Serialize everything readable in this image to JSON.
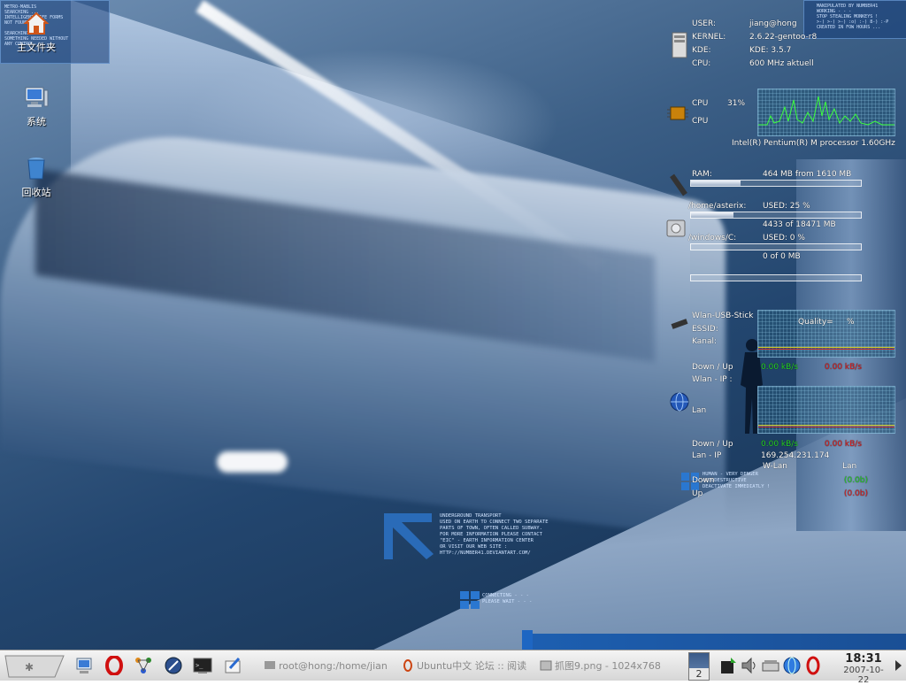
{
  "desktop": {
    "icons": [
      {
        "label": "主文件夹",
        "icon": "home-folder-icon"
      },
      {
        "label": "系统",
        "icon": "computer-icon"
      },
      {
        "label": "回收站",
        "icon": "trash-icon"
      }
    ],
    "top_left_panel": "METRO-MABLIS\nSEARCHING ...\nINTELLIGENT LIFE FORMS\nNOT FOUND\n\nSEARCHING ...\nSOMETHING NEEDED WITHOUT\nANY CONTROL",
    "top_right_panel": "MANIPULATED BY NUMBER41\nWORKING - - -\nSTOP STEALING MONKEYS !\n>-) >-) >-) :o) :-) 8-) :-P\nCREATED IN FOW HOURS ...",
    "bottom_text": "UNDERGROUND TRANSPORT\nUSED ON EARTH TO CONNECT TWO SEPARATE\nPARTS OF TOWN, OFTEN CALLED SUBWAY.\nFOR MORE INFORMATION PLEASE CONTACT\n\"EIC\" - EARTH INFORMATION CENTER\nOR VISIT OUR WEB SITE :\nHTTP://NUMBER41.DEVIANTART.COM/",
    "connecting_text": "CONNECTING - - -\nPLEASE WAIT - - -",
    "warning_text": "HUMAN - VERY DENGER\nAUTODESTRUCTIVE\nDEACTIVATE IMMEDIATLY !"
  },
  "sysinfo": {
    "user_label": "USER:",
    "user": "jiang@hong",
    "kernel_label": "KERNEL:",
    "kernel": "2.6.22-gentoo-r8",
    "kde_label": "KDE:",
    "kde": "KDE: 3.5.7",
    "cpu_label": "CPU:",
    "cpu": "600 MHz aktuell"
  },
  "cpu_monitor": {
    "label1": "CPU",
    "label2": "CPU",
    "percent": "31%",
    "processor": "Intel(R) Pentium(R) M processor 1.60GHz",
    "load_fraction": 0.31
  },
  "memory": {
    "ram_label": "RAM:",
    "ram_value": "464 MB from 1610 MB",
    "ram_fraction": 0.29,
    "home_label": "/home/asterix:",
    "home_used": "USED: 25 %",
    "home_detail": "4433 of 18471 MB",
    "home_fraction": 0.25,
    "win_label": "/windows/C:",
    "win_used": "USED: 0 %",
    "win_detail": "0 of 0 MB",
    "win_fraction": 0.0
  },
  "network": {
    "wlan_title": "Wlan-USB-Stick",
    "quality_label": "Quality=",
    "quality_unit": "%",
    "essid_label": "ESSID:",
    "kanal_label": "Kanal:",
    "wlan_downup_label": "Down / Up",
    "wlan_down": "0.00 kB/s",
    "wlan_up": "0.00 kB/s",
    "wlan_ip_label": "Wlan - IP :",
    "lan_title": "Lan",
    "lan_downup_label": "Down / Up",
    "lan_down": "0.00 kB/s",
    "lan_up": "0.00 kB/s",
    "lan_ip_label": "Lan - IP",
    "lan_ip": "169.254.231.174",
    "wlan_col": "W-Lan",
    "lan_col": "Lan",
    "down_label": "Down",
    "up_label": "Up",
    "lan_down_total": "(0.0b)",
    "lan_up_total": "(0.0b)"
  },
  "taskbar": {
    "launchers": [
      "kde-menu-icon",
      "computer-icon",
      "opera-icon",
      "network-icon",
      "web-browser-icon",
      "terminal-icon",
      "text-editor-icon"
    ],
    "tasks": [
      {
        "label": "root@hong:/home/jian",
        "icon": "terminal-icon"
      },
      {
        "label": "Ubuntu中文 论坛 :: 阅读",
        "icon": "opera-icon"
      },
      {
        "label": "抓图9.png - 1024x768",
        "icon": "image-viewer-icon"
      }
    ],
    "desktop_number": "2",
    "tray": [
      "update-icon",
      "volume-icon",
      "scanner-icon",
      "network-globe-icon",
      "opera-icon"
    ],
    "time": "18:31",
    "date": "2007-10-22"
  }
}
